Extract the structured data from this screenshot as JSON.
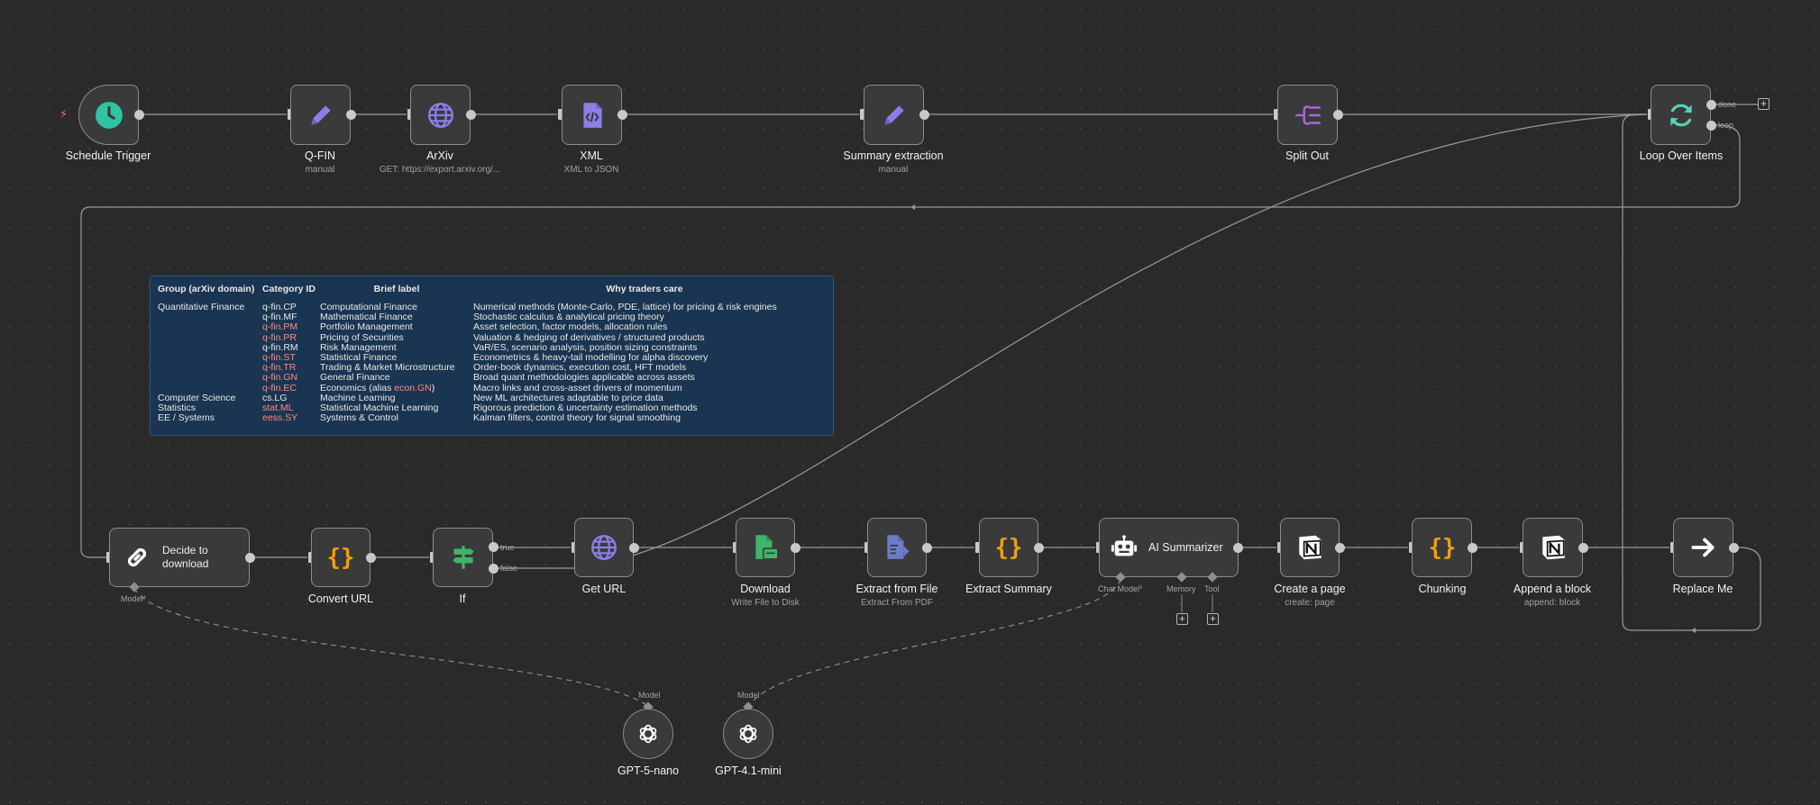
{
  "trigger_bolt": "⚡",
  "nodes": {
    "schedule_trigger": {
      "title": "Schedule Trigger"
    },
    "q_fin": {
      "title": "Q-FIN",
      "subtitle": "manual"
    },
    "arxiv": {
      "title": "ArXiv",
      "subtitle": "GET: https://export.arxiv.org/..."
    },
    "xml": {
      "title": "XML",
      "subtitle": "XML to JSON"
    },
    "summary_extraction": {
      "title": "Summary extraction",
      "subtitle": "manual"
    },
    "split_out": {
      "title": "Split Out"
    },
    "loop_over_items": {
      "title": "Loop Over Items",
      "port_done": "done",
      "port_loop": "loop"
    },
    "decide_to_download": {
      "title": "Decide to\ndownload",
      "port_model": "Model"
    },
    "convert_url": {
      "title": "Convert URL"
    },
    "if": {
      "title": "If",
      "port_true": "true",
      "port_false": "false"
    },
    "get_url": {
      "title": "Get URL"
    },
    "download": {
      "title": "Download",
      "subtitle": "Write File to Disk"
    },
    "extract_from_file": {
      "title": "Extract from File",
      "subtitle": "Extract From PDF"
    },
    "extract_summary": {
      "title": "Extract Summary"
    },
    "ai_summarizer": {
      "title": "AI Summarizer",
      "port_chat_model": "Chat Model",
      "port_memory": "Memory",
      "port_tool": "Tool"
    },
    "create_a_page": {
      "title": "Create a page",
      "subtitle": "create: page"
    },
    "chunking": {
      "title": "Chunking"
    },
    "append_a_block": {
      "title": "Append a block",
      "subtitle": "append: block"
    },
    "replace_me": {
      "title": "Replace Me"
    },
    "gpt5nano": {
      "title": "GPT-5-nano",
      "port_label": "Model"
    },
    "gpt41mini": {
      "title": "GPT-4.1-mini",
      "port_label": "Model"
    }
  },
  "sticky_note": {
    "headers": [
      "Group (arXiv domain)",
      "Category ID",
      "Brief label",
      "Why traders care"
    ],
    "rows": [
      {
        "group": "Quantitative Finance",
        "id": "q-fin.CP",
        "label": "Computational Finance",
        "why": "Numerical methods (Monte-Carlo, PDE, lattice) for pricing & risk engines"
      },
      {
        "group": "",
        "id": "q-fin.MF",
        "label": "Mathematical Finance",
        "why": "Stochastic calculus & analytical pricing theory"
      },
      {
        "group": "",
        "id": "q-fin.PM",
        "label": "Portfolio Management",
        "why": "Asset selection, factor models, allocation rules"
      },
      {
        "group": "",
        "id": "q-fin.PR",
        "label": "Pricing of Securities",
        "why": "Valuation & hedging of derivatives / structured products"
      },
      {
        "group": "",
        "id": "q-fin.RM",
        "label": "Risk Management",
        "why": "VaR/ES, scenario analysis, position sizing constraints"
      },
      {
        "group": "",
        "id": "q-fin.ST",
        "label": "Statistical Finance",
        "why": "Econometrics & heavy-tail modelling for alpha discovery"
      },
      {
        "group": "",
        "id": "q-fin.TR",
        "label": "Trading & Market Microstructure",
        "why": "Order-book dynamics, execution cost, HFT models"
      },
      {
        "group": "",
        "id": "q-fin.GN",
        "label": "General Finance",
        "why": "Broad quant methodologies applicable across assets"
      },
      {
        "group": "",
        "id": "q-fin.EC",
        "label_prefix": "Economics (alias ",
        "label_alias": "econ.GN",
        "label_suffix": ")",
        "why": "Macro links and cross-asset drivers of momentum"
      },
      {
        "group": "Computer Science",
        "id": "cs.LG",
        "label": "Machine Learning",
        "why": "New ML architectures adaptable to price data"
      },
      {
        "group": "Statistics",
        "id": "stat.ML",
        "label": "Statistical Machine Learning",
        "why": "Rigorous prediction & uncertainty estimation methods"
      },
      {
        "group": "EE / Systems",
        "id": "eess.SY",
        "label": "Systems & Control",
        "why": "Kalman filters, control theory for signal smoothing"
      }
    ]
  },
  "colors": {
    "canvas": "#2a2a2a",
    "node_bg": "#3a3a3a",
    "node_border": "#8c8c8c",
    "accent_red": "#ff6d5a",
    "sticky_bg": "#1a3551",
    "schedule_icon": "#2fc4a0",
    "edit_icon": "#8b7fe8",
    "http_icon": "#8b7fe8",
    "code_icon": "#f59d0b",
    "if_icon": "#3fb569",
    "download_icon": "#3fb569",
    "extract_icon": "#6b7cc9",
    "loop_icon": "#58d3b6"
  }
}
